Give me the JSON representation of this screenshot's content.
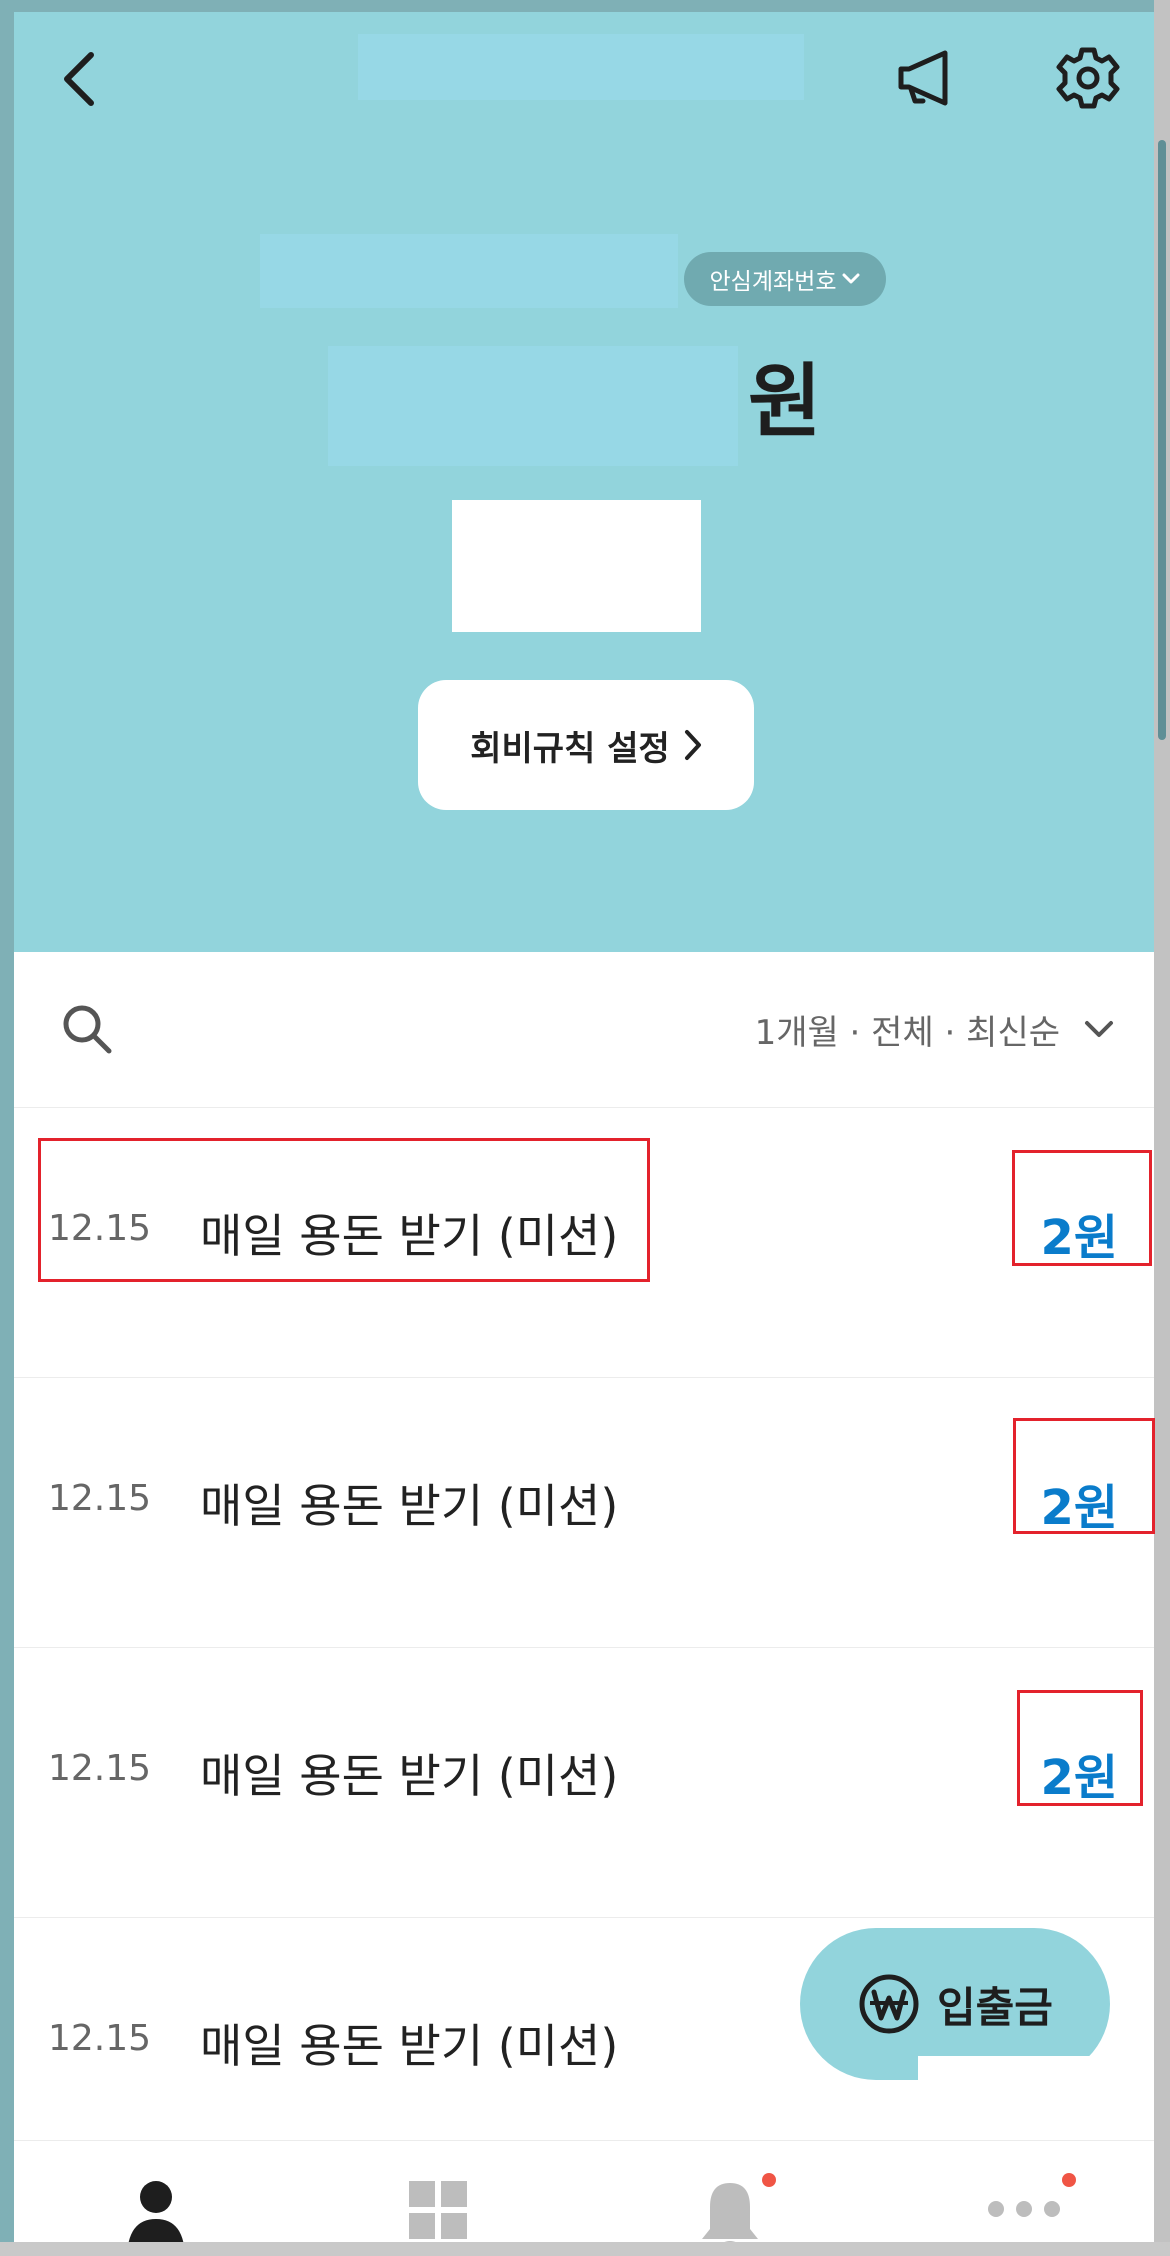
{
  "header": {
    "safe_account_label": "안심계좌번호",
    "currency_unit": "원",
    "rules_button_label": "회비규칙 설정"
  },
  "filter": {
    "label": "1개월 · 전체 · 최신순"
  },
  "transactions": [
    {
      "date": "12.15",
      "title": "매일 용돈 받기 (미션)",
      "amount": "2원"
    },
    {
      "date": "12.15",
      "title": "매일 용돈 받기 (미션)",
      "amount": "2원"
    },
    {
      "date": "12.15",
      "title": "매일 용돈 받기 (미션)",
      "amount": "2원"
    },
    {
      "date": "12.15",
      "title": "매일 용돈 받기 (미션)",
      "amount": ""
    }
  ],
  "fab": {
    "label": "입출금"
  },
  "tabbar": {
    "items": [
      {
        "icon": "person-icon",
        "active": true
      },
      {
        "icon": "grid-icon",
        "active": false
      },
      {
        "icon": "bell-icon",
        "active": false,
        "badge": true
      },
      {
        "icon": "more-icon",
        "active": false,
        "badge": true
      }
    ]
  },
  "colors": {
    "header_bg": "#92d4dc",
    "amount_blue": "#0a7ccb",
    "highlight_red": "#e3222c",
    "badge_red": "#f05545"
  }
}
